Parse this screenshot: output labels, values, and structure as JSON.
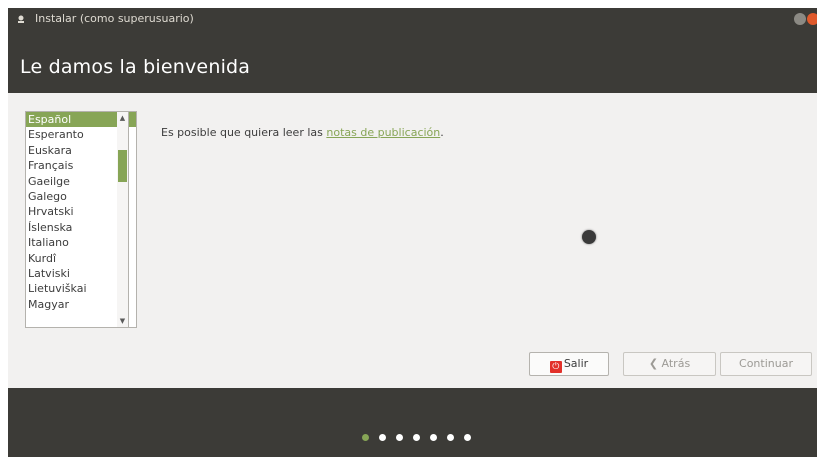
{
  "window": {
    "title": "Instalar (como superusuario)"
  },
  "header": {
    "title": "Le damos la bienvenida"
  },
  "languages": [
    "Español",
    "Esperanto",
    "Euskara",
    "Français",
    "Gaeilge",
    "Galego",
    "Hrvatski",
    "Íslenska",
    "Italiano",
    "Kurdî",
    "Latviski",
    "Lietuviškai",
    "Magyar"
  ],
  "selected_language": "Español",
  "notes": {
    "prefix": "Es posible que quiera leer las ",
    "link": "notas de publicación",
    "suffix": "."
  },
  "buttons": {
    "quit": "Salir",
    "back": "Atrás",
    "continue": "Continuar"
  },
  "progress": {
    "total_steps": 7,
    "current_step": 1
  },
  "colors": {
    "accent": "#87a556",
    "dark": "#3c3b37",
    "close": "#e05a2c"
  }
}
